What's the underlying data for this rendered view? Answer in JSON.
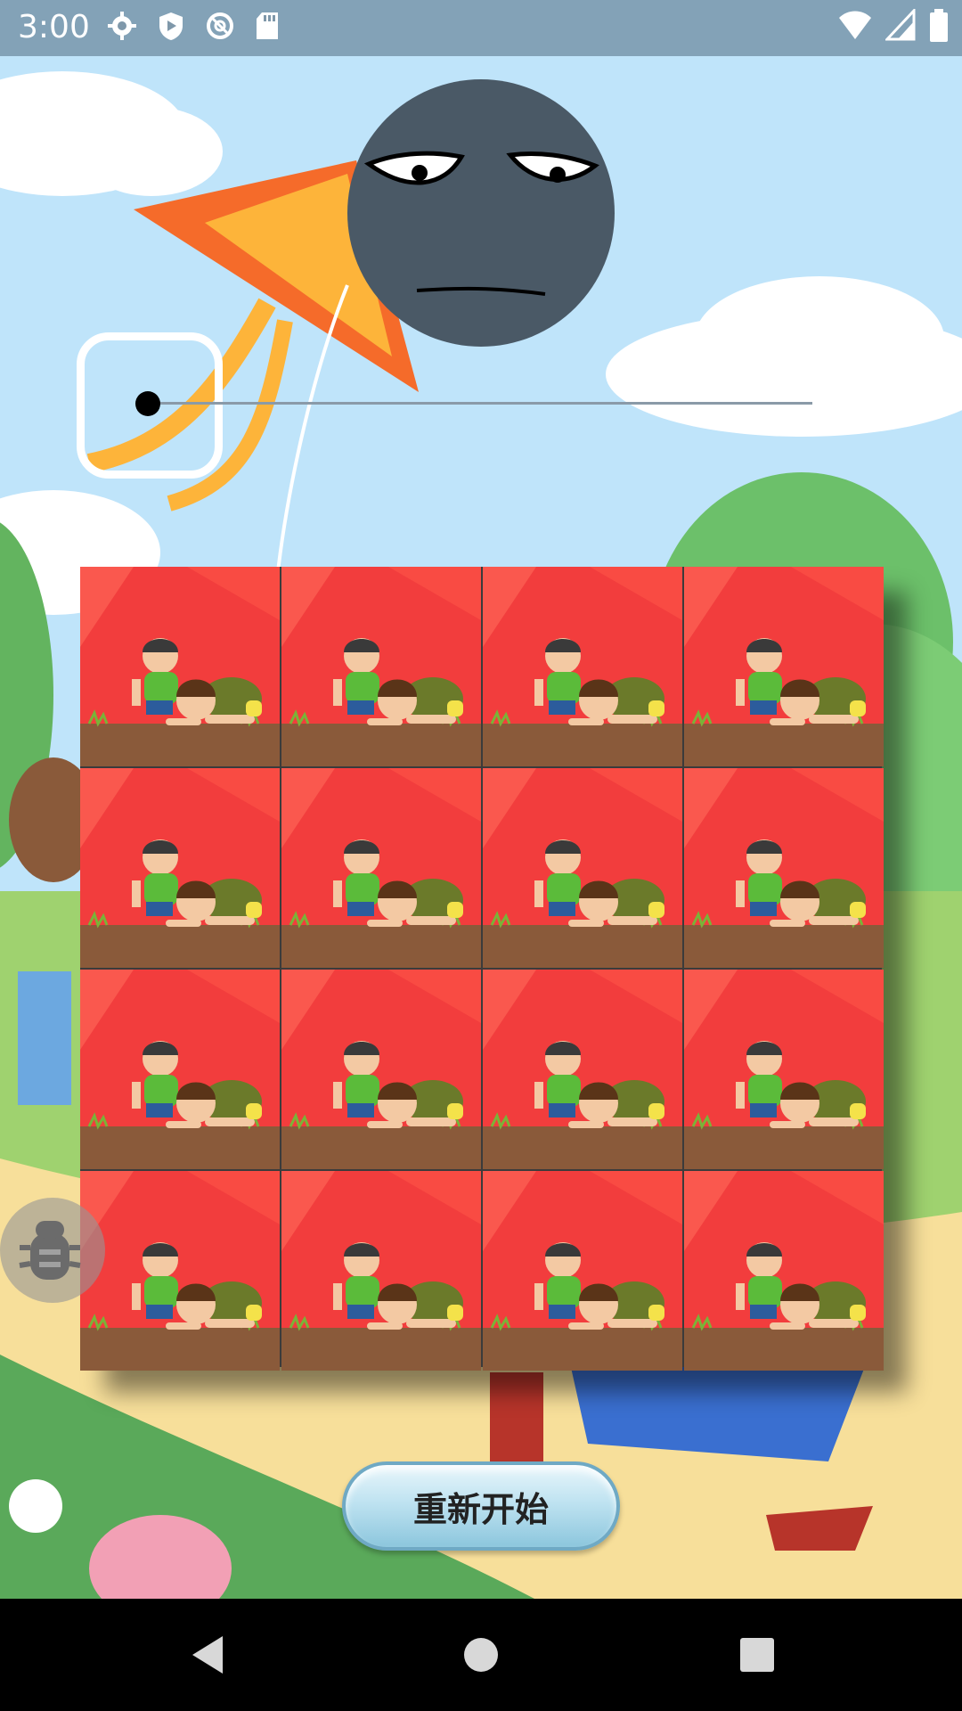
{
  "status_bar": {
    "time": "3:00",
    "icons": [
      "settings-icon",
      "shield-icon",
      "sync-icon",
      "sd-card-icon"
    ],
    "right_icons": [
      "wifi-icon",
      "cellular-icon",
      "battery-icon"
    ]
  },
  "slider": {
    "value": 0
  },
  "puzzle": {
    "rows": 4,
    "cols": 4,
    "tile_colors": {
      "background": "#f23d3d",
      "ground": "#8a5a3a"
    }
  },
  "restart_button": {
    "label": "重新开始"
  },
  "navigation": {
    "items": [
      "back-icon",
      "home-icon",
      "recents-icon"
    ]
  },
  "colors": {
    "face": "#4a5966",
    "sky": "#bfe4fa",
    "kite_orange": "#f56b2a",
    "kite_yellow": "#fdb43a"
  }
}
